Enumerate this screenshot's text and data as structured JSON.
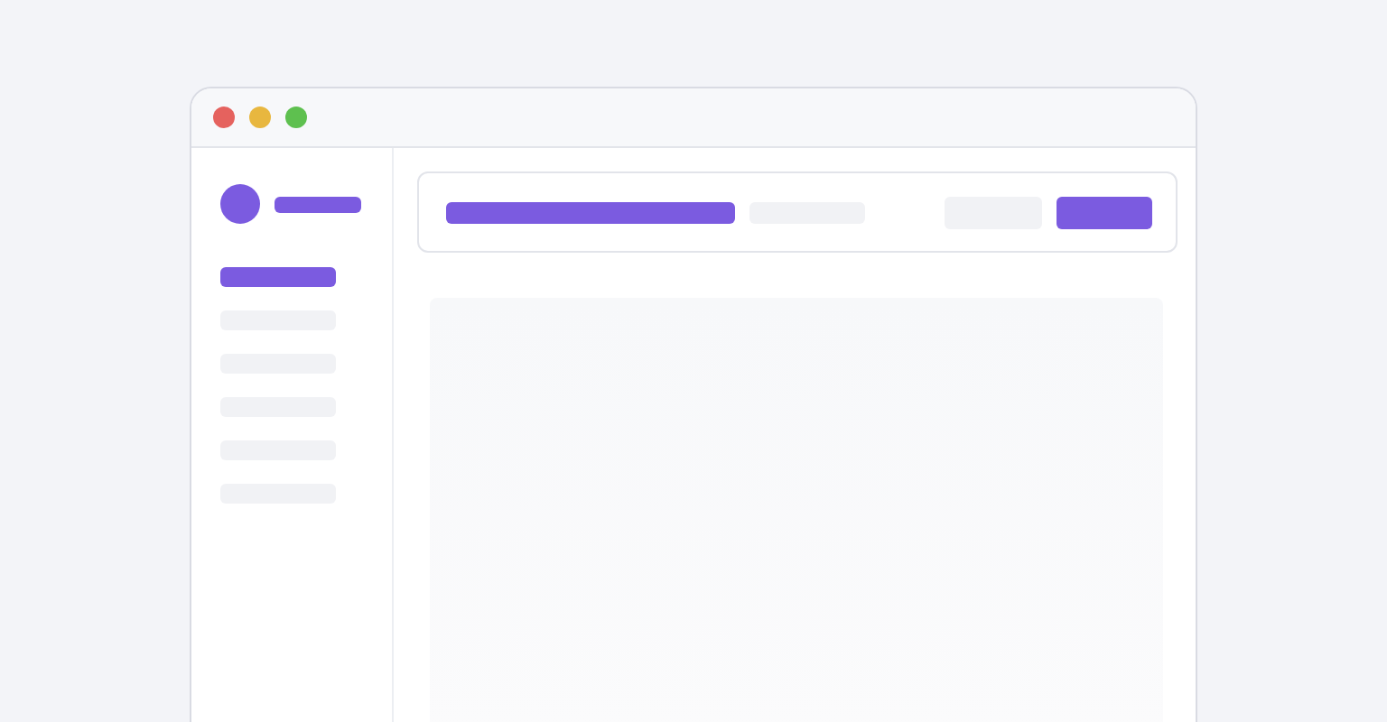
{
  "sidebar": {
    "items": [
      {
        "selected": true
      },
      {
        "selected": false
      },
      {
        "selected": false
      },
      {
        "selected": false
      },
      {
        "selected": false
      },
      {
        "selected": false
      }
    ]
  },
  "header": {
    "buttons": [
      {
        "kind": "secondary"
      },
      {
        "kind": "primary"
      }
    ]
  }
}
